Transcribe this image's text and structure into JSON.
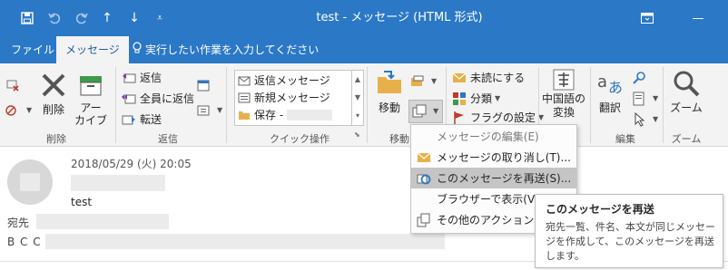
{
  "window": {
    "title": "test  -  メッセージ (HTML 形式)",
    "qat": {
      "save": "save-icon",
      "undo": "undo-icon",
      "redo": "redo-icon",
      "up": "↑",
      "down": "↓",
      "customize": "⩡"
    },
    "controls": {
      "restore_ribbon": "ribbon-display-icon",
      "minimize": "—"
    }
  },
  "tabs": {
    "file": "ファイル",
    "message": "メッセージ"
  },
  "tell_me": "実行したい作業を入力してください",
  "ribbon": {
    "delete_group": {
      "label": "削除",
      "delete": "削除",
      "archive_line1": "アー",
      "archive_line2": "カイブ"
    },
    "reply_group": {
      "label": "返信",
      "reply": "返信",
      "reply_all": "全員に返信",
      "forward": "転送"
    },
    "quick_steps": {
      "label": "クイック操作",
      "items": [
        "返信メッセージ",
        "新規メッセージ",
        "保存 -"
      ]
    },
    "move_group": {
      "label": "移動",
      "move": "移動"
    },
    "tags_group": {
      "unread": "未読にする",
      "categorize": "分類",
      "follow_up": "フラグの設定"
    },
    "chinese": {
      "line1": "中国語の",
      "line2": "変換"
    },
    "edit_group": {
      "label": "編集",
      "translate": "翻訳"
    },
    "zoom_group": {
      "label": "ズーム",
      "zoom": "ズーム"
    }
  },
  "message": {
    "date": "2018/05/29 (火) 20:05",
    "subject": "test",
    "to_label": "宛先",
    "bcc_label": "B C C"
  },
  "menu": {
    "items": [
      {
        "label": "メッセージの編集(E)",
        "icon": "edit-message-icon"
      },
      {
        "label": "メッセージの取り消し(T)...",
        "icon": "recall-icon"
      },
      {
        "label": "このメッセージを再送(S)...",
        "icon": "resend-icon"
      },
      {
        "label": "ブラウザーで表示(V)",
        "icon": ""
      },
      {
        "label": "その他のアクション(O)",
        "icon": "other-actions-icon"
      }
    ]
  },
  "tooltip": {
    "title": "このメッセージを再送",
    "body": "宛先一覧、件名、本文が同じメッセージを作成して、このメッセージを再送します。"
  },
  "colors": {
    "accent": "#2b78c6",
    "ribbon_bg": "#f3f3f3",
    "highlight": "#c5c5c5"
  }
}
